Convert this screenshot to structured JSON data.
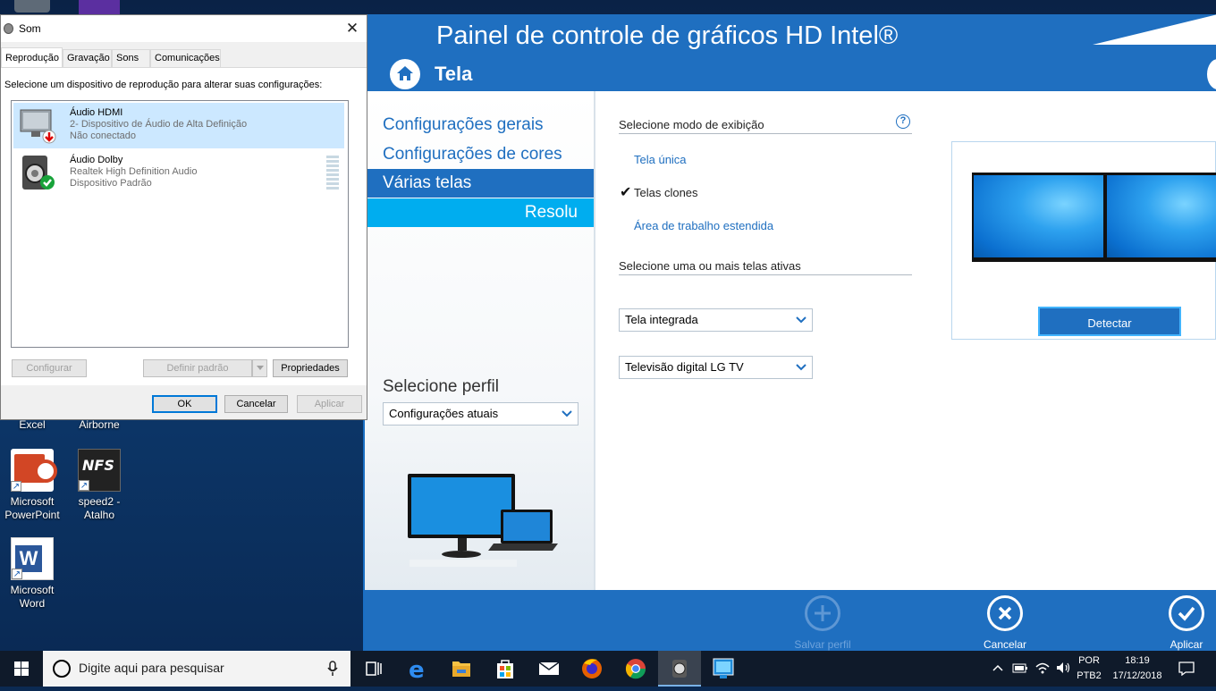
{
  "desktop": {
    "icons": [
      {
        "label": "Excel"
      },
      {
        "label": "Airborne"
      },
      {
        "label": "Microsoft PowerPoint"
      },
      {
        "label": "speed2 - Atalho"
      },
      {
        "label": "Microsoft Word"
      }
    ]
  },
  "sound_dialog": {
    "title": "Som",
    "close_label": "✕",
    "tabs": [
      {
        "label": "Reprodução"
      },
      {
        "label": "Gravação"
      },
      {
        "label": "Sons"
      },
      {
        "label": "Comunicações"
      }
    ],
    "instruction": "Selecione um dispositivo de reprodução para alterar suas configurações:",
    "devices": [
      {
        "name": "Áudio HDMI",
        "line2": "2- Dispositivo de Áudio de Alta Definição",
        "line3": "Não conectado"
      },
      {
        "name": "Áudio Dolby",
        "line2": "Realtek High Definition Audio",
        "line3": "Dispositivo Padrão"
      }
    ],
    "buttons": {
      "configure": "Configurar",
      "set_default": "Definir padrão",
      "properties": "Propriedades",
      "ok": "OK",
      "cancel": "Cancelar",
      "apply": "Aplicar"
    }
  },
  "intel_panel": {
    "title": "Painel de controle de gráficos HD Intel®",
    "section": "Tela",
    "sidebar": {
      "items": [
        {
          "label": "Configurações gerais"
        },
        {
          "label": "Configurações de cores"
        },
        {
          "label": "Várias telas"
        },
        {
          "label": "Resolu"
        }
      ],
      "profile_label": "Selecione perfil",
      "profile_value": "Configurações atuais"
    },
    "display_mode": {
      "heading": "Selecione modo de exibição",
      "help": "?",
      "options": [
        {
          "label": "Tela única",
          "selected": false
        },
        {
          "label": "Telas clones",
          "selected": true
        },
        {
          "label": "Área de trabalho estendida",
          "selected": false
        }
      ],
      "check_mark": "✔"
    },
    "active_displays": {
      "heading": "Selecione uma ou mais telas ativas",
      "display1": "Tela integrada",
      "display2": "Televisão digital LG TV"
    },
    "detect_button": "Detectar",
    "footer": {
      "save_profile": "Salvar perfil",
      "cancel": "Cancelar",
      "apply": "Aplicar"
    }
  },
  "taskbar": {
    "search_placeholder": "Digite aqui para pesquisar",
    "language": "POR",
    "layout": "PTB2",
    "time": "18:19",
    "date": "17/12/2018"
  },
  "colors": {
    "intel_blue": "#1f6fc0",
    "intel_cyan": "#00adef",
    "selection": "#cce8ff"
  }
}
